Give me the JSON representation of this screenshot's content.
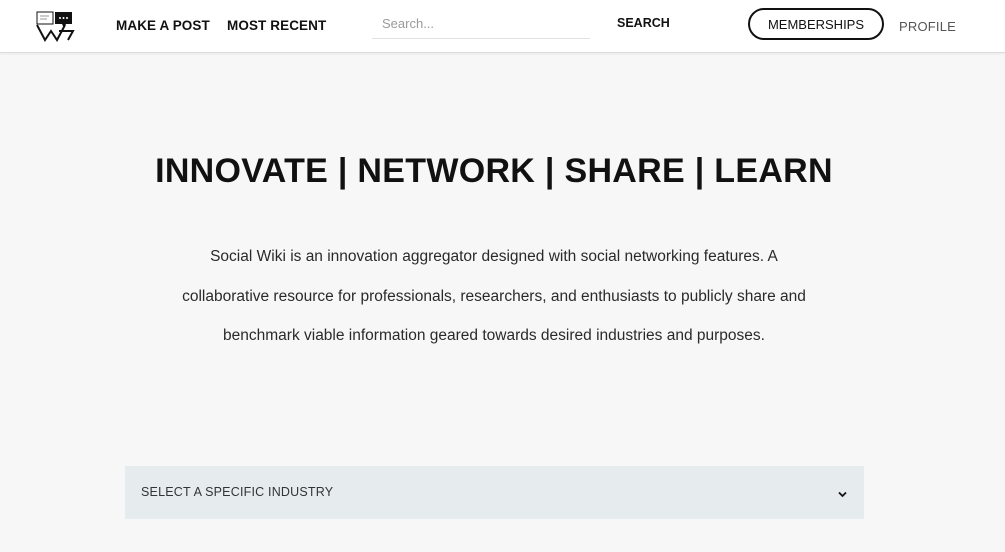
{
  "header": {
    "logo": "wiki-logo-icon",
    "nav": {
      "make_post": "MAKE A POST",
      "most_recent": "MOST RECENT"
    },
    "search": {
      "placeholder": "Search...",
      "button_label": "SEARCH"
    },
    "memberships_label": "MEMBERSHIPS",
    "profile_label": "PROFILE"
  },
  "hero": {
    "title": "INNOVATE | NETWORK | SHARE | LEARN",
    "description": "Social Wiki is an innovation aggregator designed with social networking features. A collaborative resource for professionals, researchers, and enthusiasts to publicly share and benchmark viable information geared towards desired industries and purposes."
  },
  "industry_select": {
    "selected": "SELECT A SPECIFIC INDUSTRY",
    "icon": "chevron-down-icon"
  },
  "colors": {
    "background": "#f7f7f7",
    "header": "#ffffff",
    "select_background": "#e6ecee",
    "text": "#111111"
  }
}
